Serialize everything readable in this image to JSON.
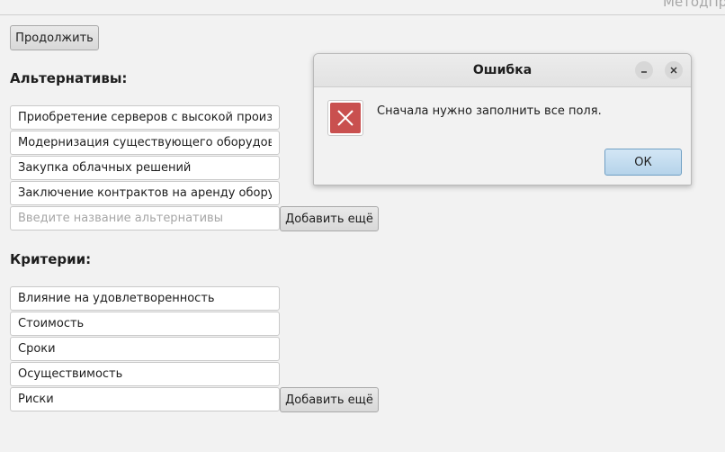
{
  "window": {
    "title": "МетодПр"
  },
  "toolbar": {
    "continue_label": "Продолжить"
  },
  "alternatives": {
    "heading": "Альтернативы:",
    "items": [
      "Приобретение серверов с высокой производительностью",
      "Модернизация существующего оборудования",
      "Закупка облачных решений",
      "Заключение контрактов на аренду оборудования"
    ],
    "new_item_placeholder": "Введите название альтернативы",
    "add_label": "Добавить ещё"
  },
  "criteria": {
    "heading": "Критерии:",
    "items": [
      "Влияние на удовлетворенность",
      "Стоимость",
      "Сроки",
      "Осуществимость",
      "Риски"
    ],
    "add_label": "Добавить ещё"
  },
  "dialog": {
    "title": "Ошибка",
    "message": "Сначала нужно заполнить все поля.",
    "ok_label": "ОК",
    "icon": "error-icon",
    "minimize_icon": "minimize-icon",
    "close_icon": "close-icon"
  },
  "colors": {
    "error_red": "#c9504f",
    "ok_button_blue": "#b5d3ea"
  }
}
